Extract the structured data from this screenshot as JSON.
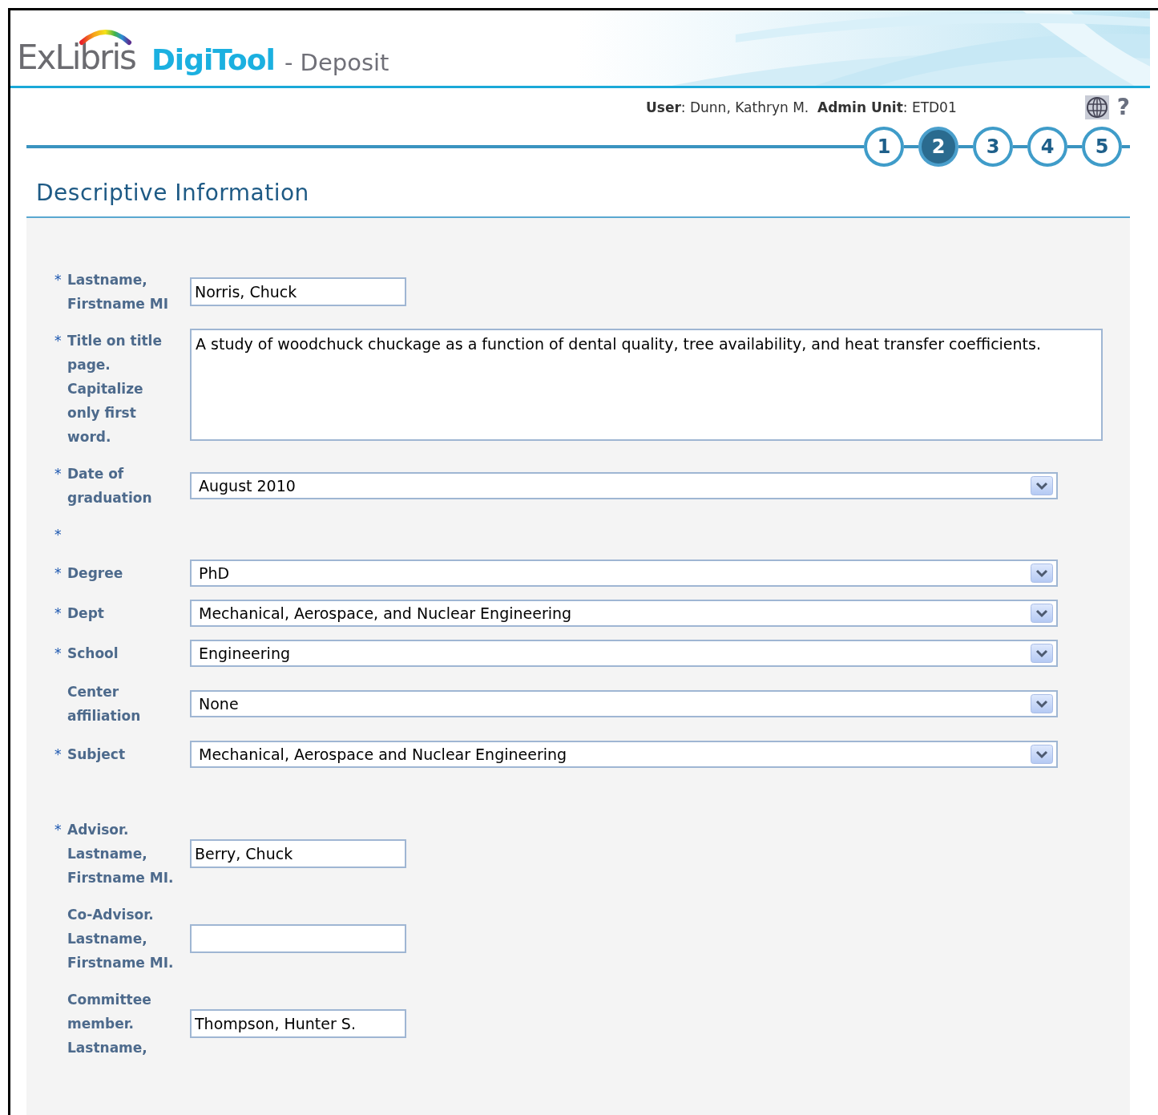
{
  "header": {
    "brand": "ExLibris",
    "product": "DigiTool",
    "module": "- Deposit"
  },
  "user_bar": {
    "info": "**User**: Dunn, Kathryn M.  **Admin Unit**: ETD01",
    "help": "?"
  },
  "steps": [
    {
      "label": "1",
      "selected": false
    },
    {
      "label": "2",
      "selected": true
    },
    {
      "label": "3",
      "selected": false
    },
    {
      "label": "4",
      "selected": false
    },
    {
      "label": "5",
      "selected": false
    }
  ],
  "page_title": "Descriptive Information",
  "sections": [
    {
      "fields": [
        {
          "kind": "text",
          "required_mark": "*",
          "label": "Lastname, Firstname MI",
          "value": "Norris, Chuck"
        },
        {
          "kind": "textarea",
          "required_mark": "*",
          "label": "Title on title page. Capitalize only first word.",
          "value": "A study of woodchuck chuckage as a function of dental quality, tree availability, and heat transfer coefficients."
        },
        {
          "kind": "select",
          "required_mark": "*",
          "label": "Date of graduation",
          "value": "August 2010"
        },
        {
          "kind": "blank",
          "required_mark": "*"
        },
        {
          "kind": "select",
          "required_mark": "*",
          "label": "Degree",
          "value": "PhD"
        },
        {
          "kind": "select",
          "required_mark": "*",
          "label": "Dept",
          "value": "Mechanical, Aerospace, and Nuclear Engineering"
        },
        {
          "kind": "select",
          "required_mark": "*",
          "label": "School",
          "value": "Engineering"
        },
        {
          "kind": "select",
          "label": "Center affiliation",
          "value": "None"
        },
        {
          "kind": "select",
          "required_mark": "*",
          "label": "Subject",
          "value": "Mechanical, Aerospace and Nuclear Engineering"
        }
      ]
    },
    {
      "fields": [
        {
          "kind": "text",
          "required_mark": "*",
          "label": "Advisor. Lastname, Firstname MI.",
          "value": "Berry, Chuck"
        },
        {
          "kind": "text",
          "label": "Co-Advisor. Lastname, Firstname MI."
        },
        {
          "kind": "text",
          "label": "Committee member. Lastname,",
          "value": "Thompson, Hunter S."
        }
      ]
    }
  ]
}
